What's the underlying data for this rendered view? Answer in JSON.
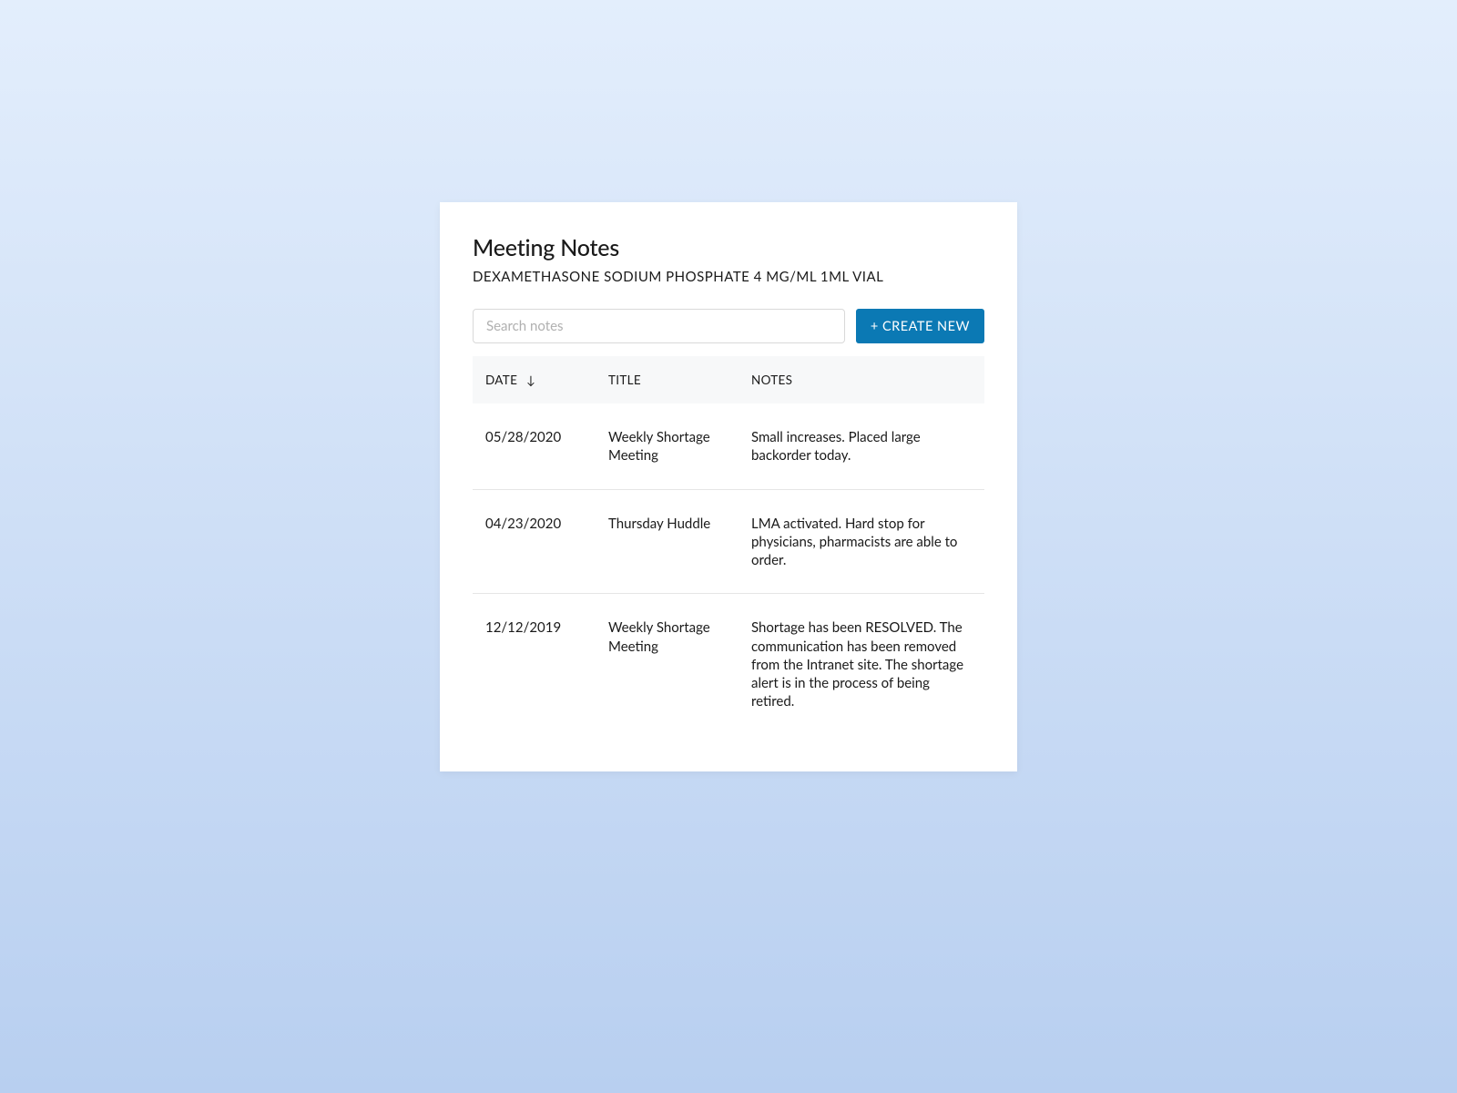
{
  "header": {
    "title": "Meeting Notes",
    "subtitle": "DEXAMETHASONE SODIUM PHOSPHATE 4 MG/ML 1ML VIAL"
  },
  "controls": {
    "search_placeholder": "Search notes",
    "create_button_label": "+ CREATE NEW"
  },
  "table": {
    "columns": {
      "date": "DATE",
      "title": "TITLE",
      "notes": "NOTES"
    },
    "sort_arrow": "↓",
    "rows": [
      {
        "date": "05/28/2020",
        "title": "Weekly Shortage Meeting",
        "notes": "Small increases. Placed large backorder today."
      },
      {
        "date": "04/23/2020",
        "title": "Thursday Huddle",
        "notes": "LMA activated. Hard stop for physicians, pharmacists are able to order."
      },
      {
        "date": "12/12/2019",
        "title": "Weekly Shortage Meeting",
        "notes": "Shortage has been RESOLVED. The communication has been removed from the Intranet site. The shortage alert is in the process of being retired."
      }
    ]
  }
}
